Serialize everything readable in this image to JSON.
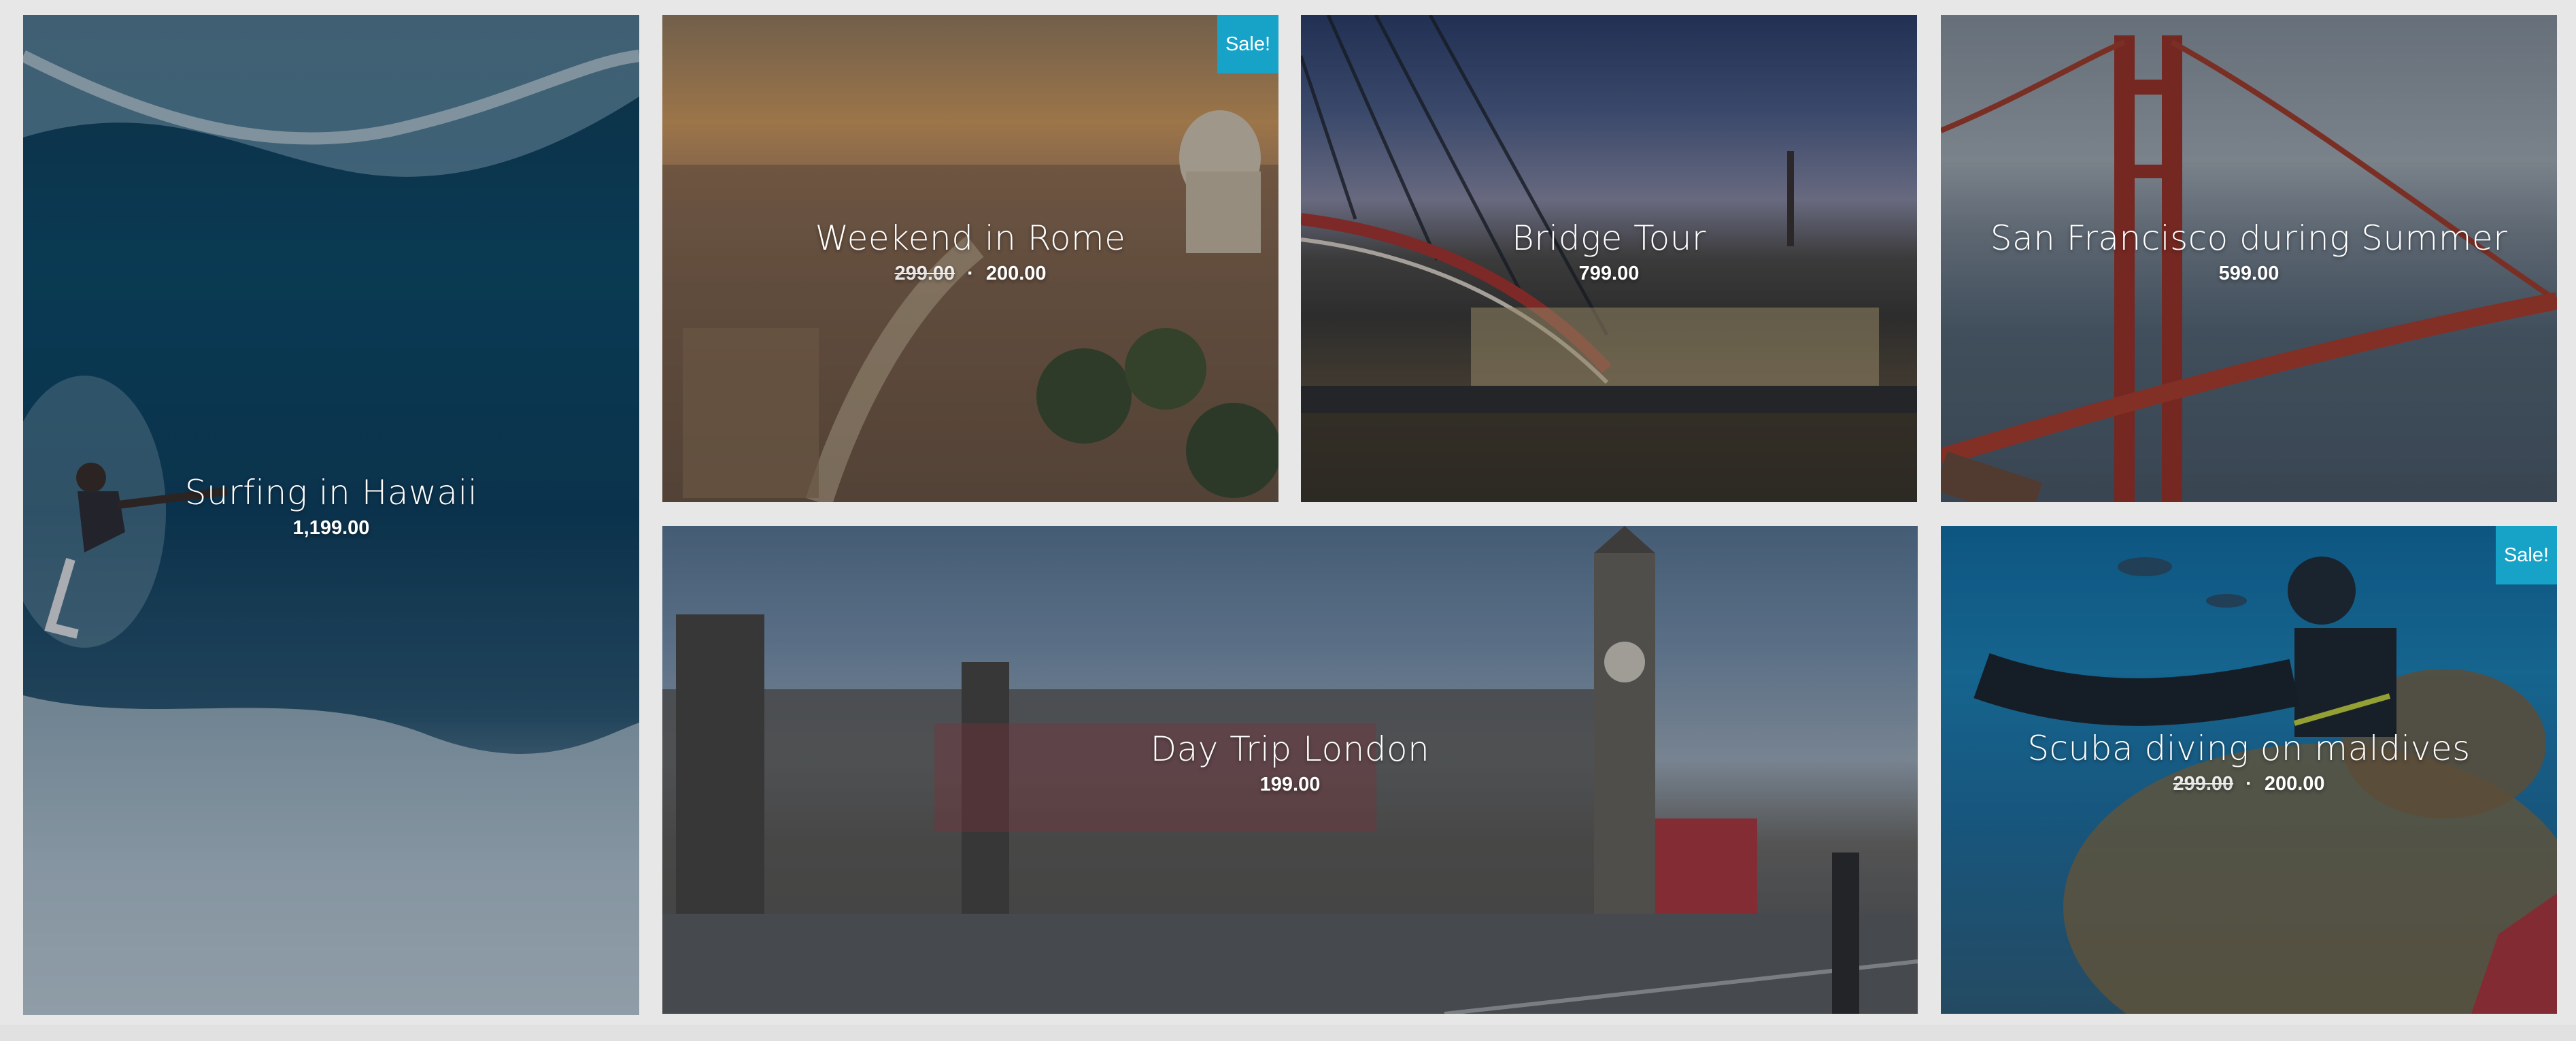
{
  "tiles": [
    {
      "id": "hawaii",
      "title": "Surfing in Hawaii",
      "price": "1,199.00"
    },
    {
      "id": "rome",
      "title": "Weekend in Rome",
      "old_price": "299.00",
      "price": "200.00",
      "badge": "Sale!"
    },
    {
      "id": "bridge",
      "title": "Bridge Tour",
      "price": "799.00"
    },
    {
      "id": "sf",
      "title": "San Francisco during Summer",
      "price": "599.00"
    },
    {
      "id": "london",
      "title": "Day Trip London",
      "price": "199.00"
    },
    {
      "id": "scuba",
      "title": "Scuba diving on maldives",
      "old_price": "299.00",
      "price": "200.00",
      "badge": "Sale!"
    }
  ],
  "colors": {
    "badge": "#17a2c8",
    "background": "#e7e7e7"
  }
}
